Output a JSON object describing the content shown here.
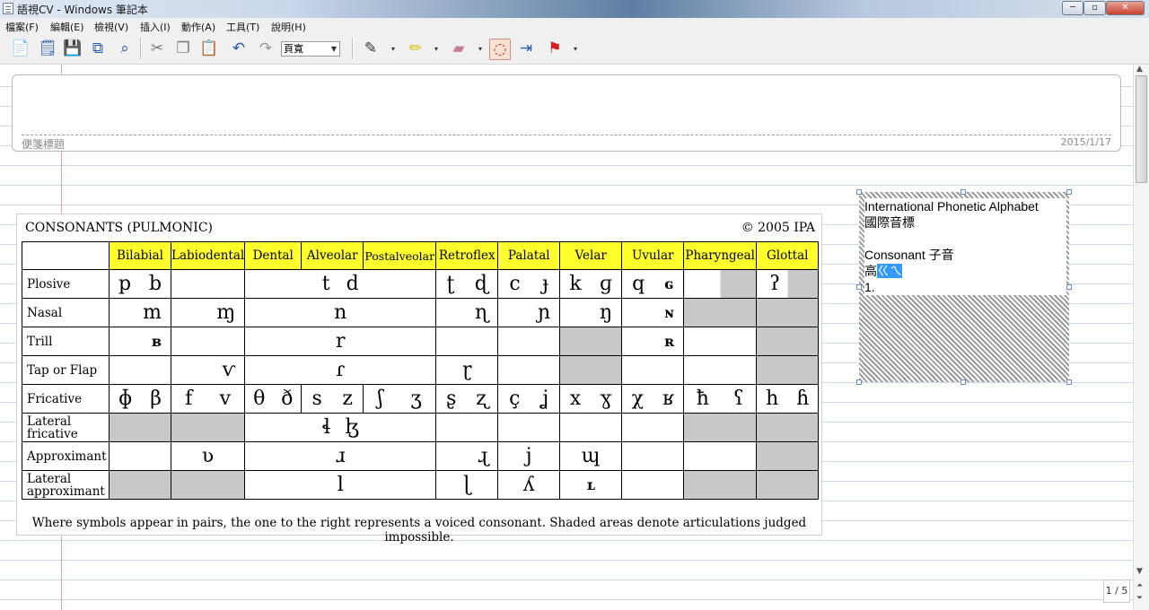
{
  "window": {
    "title": "語視CV - Windows 筆記本",
    "min": "─",
    "max": "▫",
    "close": "✕"
  },
  "menu": [
    "檔案(F)",
    "編輯(E)",
    "檢視(V)",
    "插入(I)",
    "動作(A)",
    "工具(T)",
    "說明(H)"
  ],
  "toolbar": {
    "page_width": "頁寬",
    "dropdown_arrow": "▾"
  },
  "icons": [
    "new-page-icon",
    "new-note-icon",
    "save-icon",
    "copy-page-icon",
    "search-icon",
    "cut-icon",
    "copy-icon",
    "paste-icon",
    "undo-icon",
    "redo-icon",
    "pen-icon",
    "highlighter-icon",
    "eraser-icon",
    "lasso-icon",
    "insert-space-icon",
    "flag-icon"
  ],
  "page": {
    "title_placeholder": "便箋標題",
    "date": "2015/1/17"
  },
  "ipa": {
    "title": "CONSONANTS (PULMONIC)",
    "copyright": "© 2005 IPA",
    "columns": [
      "Bilabial",
      "Labiodental",
      "Dental",
      "Alveolar",
      "Postalveolar",
      "Retroflex",
      "Palatal",
      "Velar",
      "Uvular",
      "Pharyngeal",
      "Glottal"
    ],
    "rows": {
      "plosive": "Plosive",
      "nasal": "Nasal",
      "trill": "Trill",
      "tap": "Tap or Flap",
      "fricative": "Fricative",
      "lat_fric": "Lateral fricative",
      "approx": "Approximant",
      "lat_approx": "Lateral approximant"
    },
    "symbols": {
      "p": "p",
      "b": "b",
      "t": "t",
      "d": "d",
      "rt": "ʈ",
      "rd": "ɖ",
      "c": "c",
      "jb": "ɟ",
      "k": "k",
      "g": "ɡ",
      "q": "q",
      "G": "ɢ",
      "gs": "ʔ",
      "m": "m",
      "mg": "ɱ",
      "n": "n",
      "rn": "ɳ",
      "pn": "ɲ",
      "ng": "ŋ",
      "N": "ɴ",
      "B": "ʙ",
      "r": "r",
      "R": "ʀ",
      "v_tap": "ⱱ",
      "tap": "ɾ",
      "r_tap": "ɽ",
      "phi": "ɸ",
      "beta": "β",
      "f": "f",
      "v": "v",
      "theta": "θ",
      "eth": "ð",
      "s": "s",
      "z": "z",
      "esh": "ʃ",
      "ezh": "ʒ",
      "rs": "ʂ",
      "rz": "ʐ",
      "cc": "ç",
      "jj": "ʝ",
      "x": "x",
      "gamma": "ɣ",
      "chi": "χ",
      "uvr": "ʁ",
      "hbar": "ħ",
      "ain": "ʕ",
      "h": "h",
      "hh": "ɦ",
      "lbelt": "ɬ",
      "lezh": "ɮ",
      "vhook": "ʋ",
      "tr": "ɹ",
      "rtr": "ɻ",
      "j": "j",
      "mw": "ɰ",
      "l": "l",
      "rl": "ɭ",
      "ly": "ʎ",
      "L": "ʟ"
    },
    "footnote": "Where symbols appear in pairs, the one to the right represents a voiced consonant. Shaded areas denote articulations judged impossible."
  },
  "note": {
    "line1": "International Phonetic Alphabet",
    "line2": "國際音標",
    "line3": "",
    "line4": "Consonant 子音",
    "line5_prefix": "高",
    "line5_selected": "ㄍㄟ",
    "line6": "1."
  },
  "status": {
    "page_counter": "1 / 5"
  }
}
